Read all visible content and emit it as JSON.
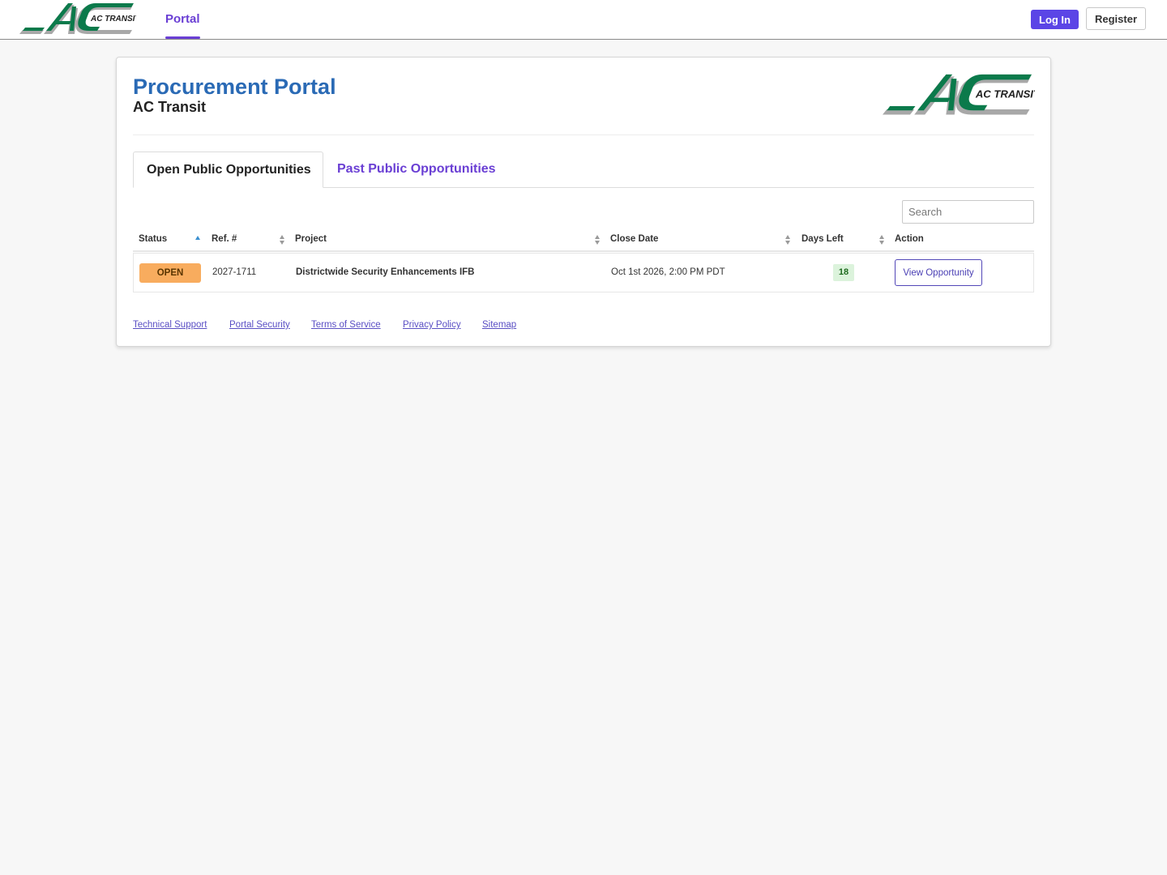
{
  "header": {
    "logo_alt": "AC TRANSIT",
    "nav_active": "Portal",
    "login_label": "Log In",
    "register_label": "Register"
  },
  "card": {
    "title": "Procurement Portal",
    "subtitle": "AC Transit",
    "logo_alt": "AC TRANSIT"
  },
  "tabs": [
    {
      "label": "Open Public Opportunities",
      "active": true
    },
    {
      "label": "Past Public Opportunities",
      "active": false
    }
  ],
  "search": {
    "placeholder": "Search",
    "value": ""
  },
  "table": {
    "columns": [
      "Status",
      "Ref. #",
      "Project",
      "Close Date",
      "Days Left",
      "Action"
    ],
    "sorted_column": "Status",
    "sort_direction": "ascending",
    "rows": [
      {
        "status": "OPEN",
        "ref": "2027-1711",
        "project": "Districtwide Security Enhancements IFB",
        "close_date": "Oct 1st 2026, 2:00 PM PDT",
        "days_left": "18",
        "action": "View Opportunity"
      }
    ]
  },
  "footer_links": [
    "Technical Support",
    "Portal Security",
    "Terms of Service",
    "Privacy Policy",
    "Sitemap"
  ],
  "colors": {
    "accent": "#6a3fd4",
    "title_blue": "#2a6ab5",
    "login_button": "#5b45e6",
    "status_open": "#f8ac5e",
    "days_left_bg": "#dcf3dc",
    "logo_green": "#0b7a4b",
    "logo_gray": "#9a9a9a"
  },
  "icons": {
    "sort_asc": "sort-ascending-icon",
    "sort_both": "sort-both-icon"
  }
}
